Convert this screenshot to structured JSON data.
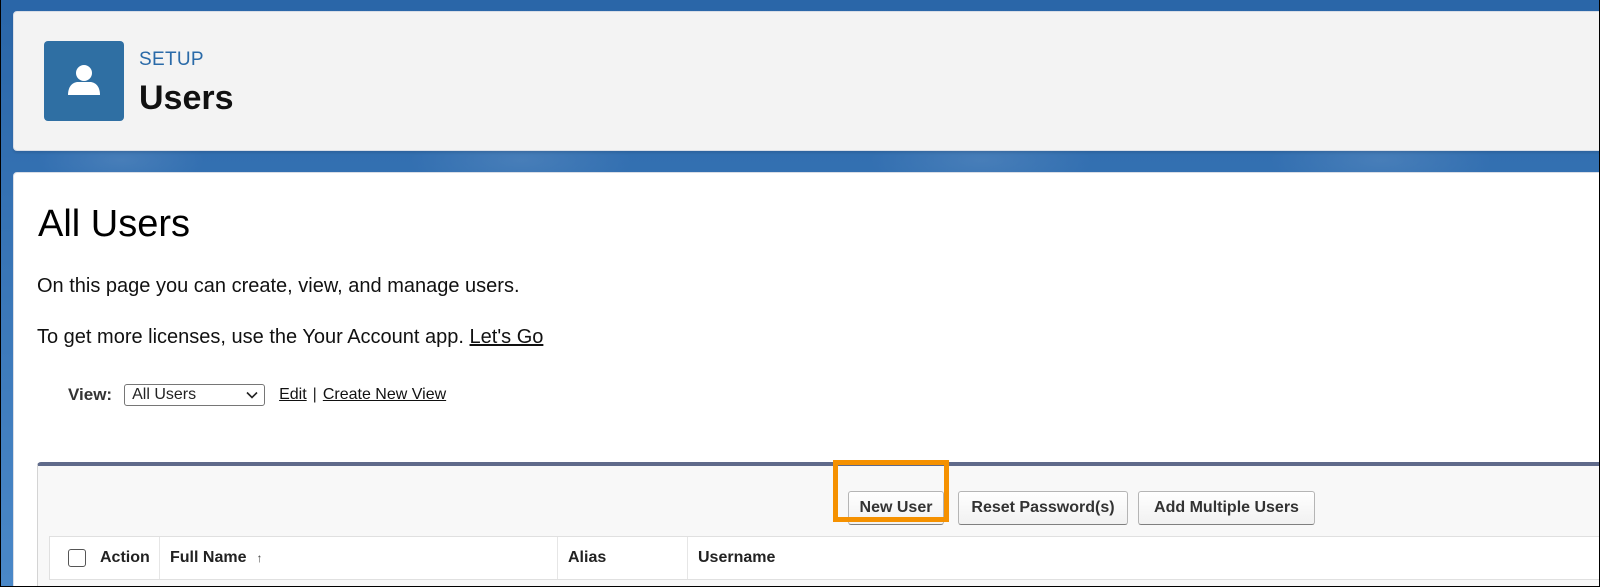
{
  "header": {
    "eyebrow": "SETUP",
    "title": "Users",
    "icon": "user-icon",
    "icon_color": "#2f6fa3"
  },
  "main": {
    "title": "All Users",
    "description": "On this page you can create, view, and manage users.",
    "licenses_text": "To get more licenses, use the Your Account app.",
    "licenses_link": "Let's Go"
  },
  "view": {
    "label": "View:",
    "selected": "All Users",
    "edit_link": "Edit",
    "separator": "|",
    "create_link": "Create New View"
  },
  "toolbar": {
    "new_user": "New User",
    "reset_password": "Reset Password(s)",
    "add_multiple": "Add Multiple Users",
    "highlight_color": "#f59100"
  },
  "table": {
    "columns": [
      {
        "label": "Action"
      },
      {
        "label": "Full Name",
        "sort": "ascending"
      },
      {
        "label": "Alias"
      },
      {
        "label": "Username"
      }
    ]
  }
}
